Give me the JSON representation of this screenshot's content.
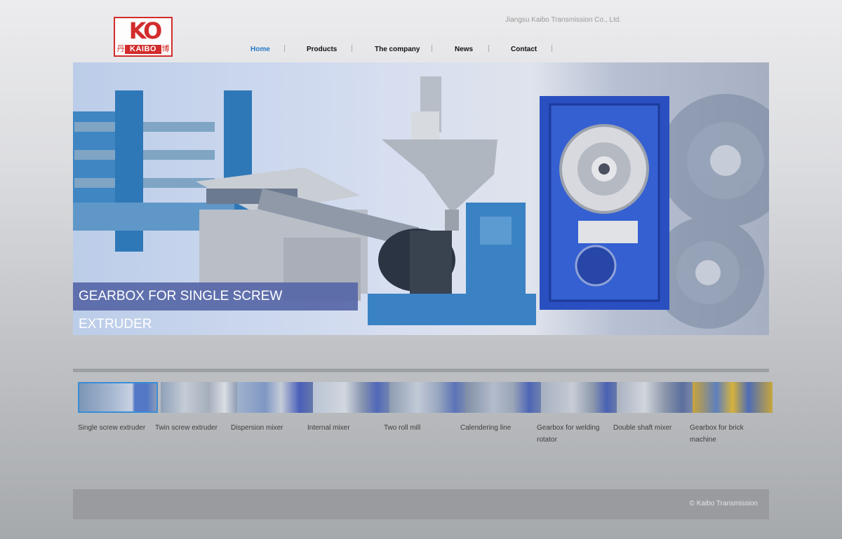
{
  "header": {
    "logo": {
      "mark": "KO",
      "word": "KAIBO",
      "left_glyph": "丹",
      "right_glyph": "博"
    },
    "company_name": "Jiangsu Kaibo Transmission Co., Ltd."
  },
  "nav": [
    {
      "label": "Home",
      "active": true
    },
    {
      "label": "Products",
      "active": false
    },
    {
      "label": "The company",
      "active": false
    },
    {
      "label": "News",
      "active": false
    },
    {
      "label": "Contact",
      "active": false
    }
  ],
  "hero": {
    "caption": "GEARBOX FOR SINGLE SCREW EXTRUDER"
  },
  "thumbnails": [
    {
      "label": "Single screw extruder",
      "active": true
    },
    {
      "label": "Twin screw extruder",
      "active": false
    },
    {
      "label": "Dispersion mixer",
      "active": false
    },
    {
      "label": "Internal mixer",
      "active": false
    },
    {
      "label": "Two roll mill",
      "active": false
    },
    {
      "label": "Calendering line",
      "active": false
    },
    {
      "label": "Gearbox for welding rotator",
      "active": false
    },
    {
      "label": "Double shaft mixer",
      "active": false
    },
    {
      "label": "Gearbox for brick machine",
      "active": false
    }
  ],
  "footer": {
    "copyright": "© Kaibo Transmission"
  },
  "colors": {
    "brand_red": "#d22c2c",
    "nav_active": "#2a78c2",
    "caption_bg": "#5767a7",
    "machine_blue": "#3a82c4"
  }
}
